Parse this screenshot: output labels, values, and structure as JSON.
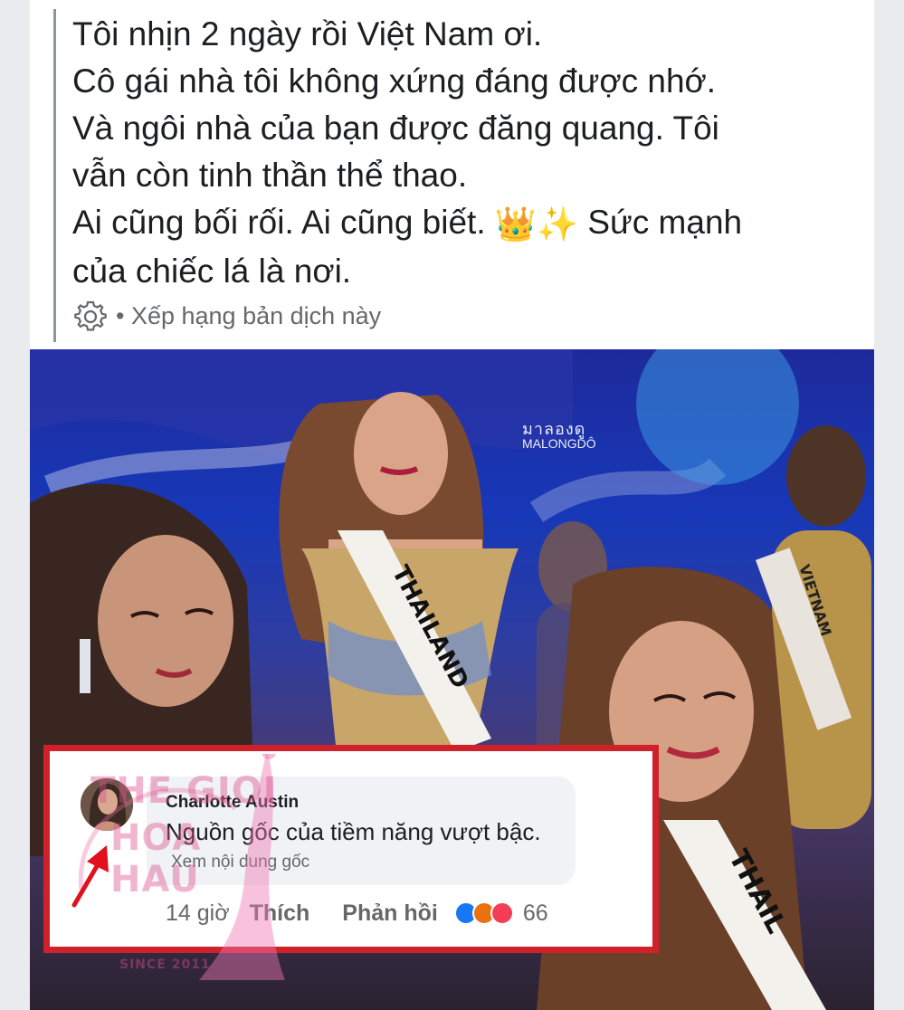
{
  "post": {
    "lines": [
      "Tôi nhịn 2 ngày rồi Việt Nam ơi.",
      "Cô gái nhà tôi không xứng đáng được nhớ.",
      "Và ngôi nhà của bạn được đăng quang. Tôi",
      "vẫn còn tinh thần thể thao.",
      "Ai cũng bối rối. Ai cũng biết.",
      "của chiếc lá là nơi."
    ],
    "line5_after_emoji": " Sức mạnh",
    "emoji": "👑✨",
    "translation_note": "• Xếp hạng bản dịch này",
    "gear_icon": "gear-icon"
  },
  "photo": {
    "watermark_thai": "มาลองดู",
    "watermark_latin": "MALONGDÔ",
    "sash_center": "THAILAND",
    "sash_right": "VIETNAM",
    "sash_bottom": "THAIL"
  },
  "comment": {
    "author": "Charlotte Austin",
    "text": "Nguồn gốc của tiềm năng vượt bậc.",
    "see_original": "Xem nội dung gốc",
    "time": "14 giờ",
    "like": "Thích",
    "reply": "Phản hồi",
    "reaction_count": "66",
    "reactions": [
      "like",
      "angry",
      "love"
    ],
    "colors": {
      "like": "#1877f2",
      "angry": "#e9710f",
      "love": "#f33e58",
      "frame": "#d0202a"
    }
  },
  "logo": {
    "line1": "THE GIOI",
    "line2": "HOA HAU",
    "line3": "SINCE 2011"
  }
}
